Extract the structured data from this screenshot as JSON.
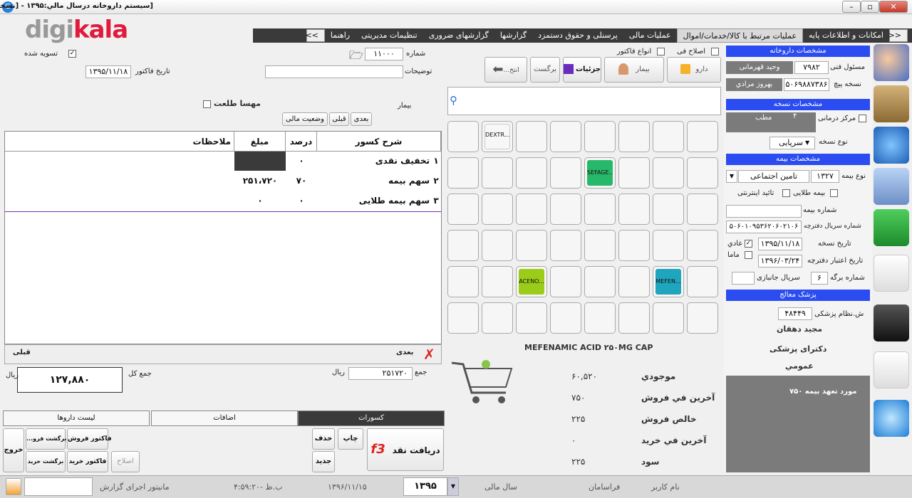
{
  "window": {
    "title": "[سیستم داروخانه درسال مالي:۱۳۹۵   -   [نسخه پیچی",
    "app_icon": "app-icon"
  },
  "logo": {
    "gray": "digi",
    "red": "kala"
  },
  "menu": {
    "items": [
      "امکانات و اطلاعات پایه",
      "عملیات مرتبط با کالا/خدمات/اموال",
      "عملیات مالی",
      "پرسنلی و حقوق دستمزد",
      "گزارشها",
      "گزارشهای ضروری",
      "تنظیمات مدیریتی",
      "راهنما"
    ],
    "nav_left": ">>",
    "nav_right": "<<"
  },
  "right": {
    "pharmacy_header": "مشخصات داروخانه",
    "responsible_label": "مسئول فنی",
    "responsible_code": "۷۹۸۲",
    "responsible_name": "وحید قهرمانی",
    "dispenser_label": "نسخه پیچ",
    "dispenser_code": "۵۰۶۹۸۸۷۳۸۶",
    "dispenser_name": "بهروز مرادي",
    "prescription_header": "مشخصات نسخه",
    "center_label": "مرکز درمانی",
    "center_num": "۴",
    "center_type": "مطب",
    "rx_type_label": "نوع نسخه",
    "rx_type_value": "سرپایی",
    "insurance_header": "مشخصات بیمه",
    "ins_type_label": "نوع بیمه",
    "ins_code": "۱۳۲۷",
    "ins_name": "تامین اجتماعی",
    "gold_label": "بیمه طلایی",
    "online_label": "تائید اینترنتی",
    "ins_num_label": "شماره بیمه",
    "serial_label": "شماره سریال دفترچه",
    "serial_value": "۵۰۶۰۱۰۹۵۳۶۲۰۶۰۲۱۰۶",
    "rx_date_label": "تاریخ نسخه",
    "rx_date": "۱۳۹۵/۱۱/۱۸",
    "normal_label": "عادي",
    "expiry_label": "تاریخ اعتبار دفترچه",
    "expiry_date": "۱۳۹۶/۰۳/۲۴",
    "mama_label": "ماما",
    "page_label": "شماره برگه",
    "page_value": "۶",
    "side_serial_label": "سریال جانبازی",
    "doctor_header": "پزشک معالج",
    "med_code_label": "ش.نظام پزشکی",
    "med_code": "۴۸۴۴۹",
    "doctor_name": "مجید دهقان",
    "doctor_degree": "دکترای پزشکی",
    "doctor_specialty": "عمومي",
    "commitment": "مورد تعهد بیمه ۷۵۰"
  },
  "toolbar": {
    "drug": "دارو",
    "patient": "بیمار",
    "details": "جزئیات",
    "return": "برگست",
    "back": "...انتخ",
    "correction": "اصلاح فی",
    "invoice_types": "انواع فاکتور"
  },
  "tiles": {
    "dextr": "DEXTR...",
    "sefage": "SEFAGE...",
    "aceno": "ACENO...",
    "mefen": "MEFEN..."
  },
  "colors": {
    "sefage": "#28b86a",
    "aceno": "#9ccc1a",
    "mefen": "#1fa5bd",
    "header_blue": "#2b4cf0"
  },
  "product": {
    "name": "MEFENAMIC ACID ۲۵۰MG CAP",
    "rows": [
      {
        "label": "موجودي",
        "value": "۶۰,۵۲۰"
      },
      {
        "label": "آخرین في فروش",
        "value": "۷۵۰"
      },
      {
        "label": "خالص فروش",
        "value": "۲۲۵"
      },
      {
        "label": "آخرین في خرید",
        "value": "۰"
      },
      {
        "label": "سود",
        "value": "۲۲۵"
      }
    ]
  },
  "left": {
    "settled_label": "تسویه شده",
    "number_label": "شماره",
    "number_value": "۱۱۰۰۰",
    "invoice_date_label": "تاریخ فاکتور",
    "invoice_date": "۱۳۹۵/۱۱/۱۸",
    "description_label": "توضیحات",
    "patient_label": "بیمار",
    "patient_name": "مهسا طلعت",
    "next": "بعدی",
    "prev": "قبلی",
    "finance": "وضعیت مالی"
  },
  "table": {
    "headers": [
      "شرح کسور",
      "درصد",
      "مبلغ",
      "ملاحظات"
    ],
    "rows": [
      {
        "n": "۱",
        "desc": "تخفیف نقدی",
        "pct": "۰",
        "amt": "",
        "note": ""
      },
      {
        "n": "۲",
        "desc": "سهم بیمه",
        "pct": "۷۰",
        "amt": "۲۵۱،۷۲۰",
        "note": ""
      },
      {
        "n": "۳",
        "desc": "سهم بیمه طلایی",
        "pct": "۰",
        "amt": "۰",
        "note": ""
      }
    ],
    "footer_next": "بعدی",
    "footer_prev": "قبلی"
  },
  "totals": {
    "sum_label": "جمع",
    "sum_value": "۲۵۱۷۲۰",
    "rial": "ریال",
    "total_label": "جمع کل",
    "total_value": "۱۲۷,۸۸۰"
  },
  "tabs": [
    "کسورات",
    "اضافات",
    "لیست داروها"
  ],
  "actions": {
    "receive": "دریافت نقد",
    "f3": "f3",
    "print": "چاپ",
    "delete": "حذف",
    "new": "جدید",
    "sale_invoice": "فاکتور فروش",
    "return_sale": "...برگشت فرو",
    "purchase_invoice": "فاکتور خرید",
    "return_purchase": "برگشت خرید",
    "fix": "اصلاح",
    "exit": "خروج"
  },
  "status": {
    "user_label": "نام کاربر",
    "user": "فراسامان",
    "year_label": "سال مالی",
    "year": "۱۳۹۵",
    "date": "۱۳۹۶/۱۱/۱۵",
    "time": "۴:۵۹:۲۰- ب.ظ",
    "report": "مانیتور اجرای گزارش"
  }
}
